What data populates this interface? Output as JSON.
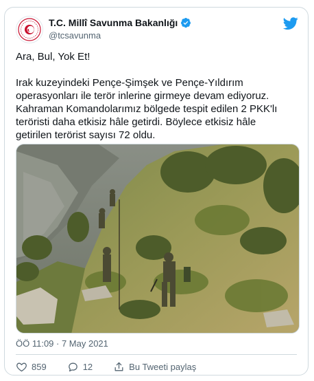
{
  "author": {
    "display_name": "T.C. Millî Savunma Bakanlığı",
    "handle": "@tcsavunma",
    "verified": true
  },
  "tweet": {
    "lines": [
      "Ara, Bul, Yok Et!",
      "",
      "Irak kuzeyindeki Pençe-Şimşek ve Pençe-Yıldırım",
      "operasyonları ile terör inlerine girmeye devam ediyoruz.",
      "Kahraman Komandolarımız bölgede tespit edilen 2 PKK'lı",
      "teröristi daha etkisiz hâle getirdi. Böylece etkisiz hâle",
      "getirilen terörist sayısı 72 oldu."
    ],
    "timestamp": "ÖÖ 11:09 · 7 May 2021"
  },
  "actions": {
    "likes": "859",
    "replies": "12",
    "share_label": "Bu Tweeti paylaş"
  },
  "colors": {
    "twitter_blue": "#1d9bf0",
    "text_secondary": "#536471",
    "border": "#cfd9de",
    "like_red": "#e0245e"
  },
  "icons": {
    "logo": "ministry-emblem-icon",
    "verified": "verified-badge-icon",
    "brand": "twitter-bird-icon",
    "like": "heart-icon",
    "reply": "reply-bubble-icon",
    "share": "share-icon"
  }
}
